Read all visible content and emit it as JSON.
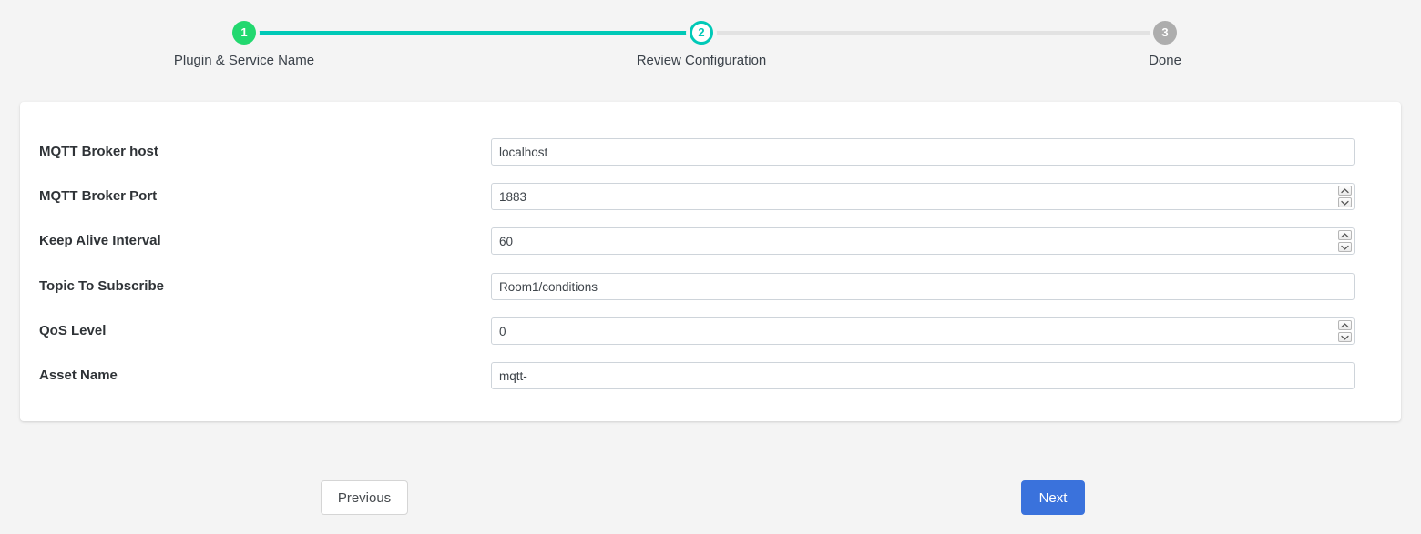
{
  "theme": {
    "page_background": "#f4f4f4",
    "card_background": "#ffffff",
    "accent_teal": "#00c9b7",
    "accent_green": "#22d86f",
    "accent_blue": "#3a72dc",
    "muted_gray": "#adadad",
    "track_todo": "#e2e2e2"
  },
  "stepper": {
    "steps": [
      {
        "number": "1",
        "label": "Plugin & Service Name",
        "state": "done"
      },
      {
        "number": "2",
        "label": "Review Configuration",
        "state": "current"
      },
      {
        "number": "3",
        "label": "Done",
        "state": "todo"
      }
    ]
  },
  "form": {
    "fields": [
      {
        "label": "MQTT Broker host",
        "value": "localhost",
        "type": "text",
        "spinner": false
      },
      {
        "label": "MQTT Broker Port",
        "value": "1883",
        "type": "number",
        "spinner": true
      },
      {
        "label": "Keep Alive Interval",
        "value": "60",
        "type": "number",
        "spinner": true
      },
      {
        "label": "Topic To Subscribe",
        "value": "Room1/conditions",
        "type": "text",
        "spinner": false
      },
      {
        "label": "QoS Level",
        "value": "0",
        "type": "number",
        "spinner": true
      },
      {
        "label": "Asset Name",
        "value": "mqtt-",
        "type": "text",
        "spinner": false
      }
    ]
  },
  "footer": {
    "previous_label": "Previous",
    "next_label": "Next"
  }
}
